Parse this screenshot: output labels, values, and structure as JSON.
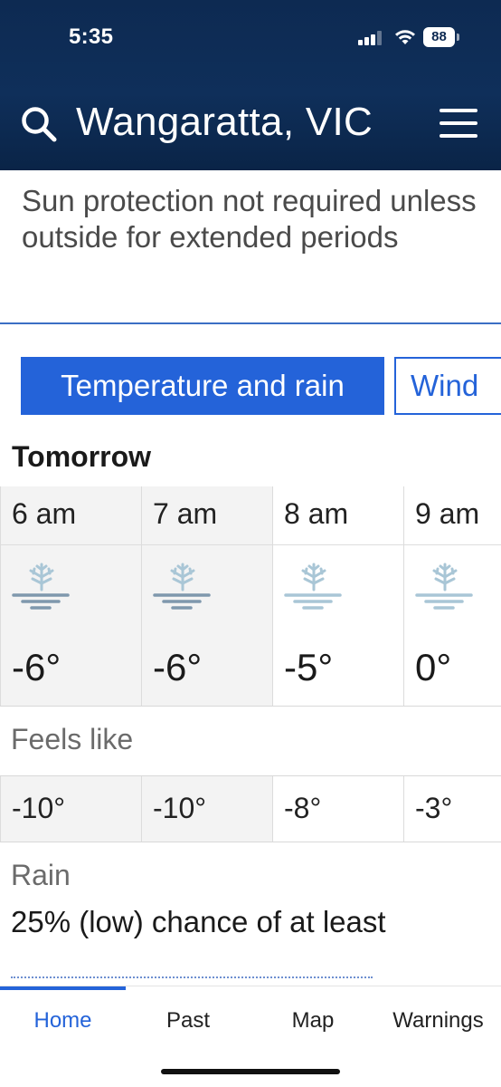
{
  "status_bar": {
    "time": "5:35",
    "battery": "88"
  },
  "header": {
    "location": "Wangaratta, VIC"
  },
  "sun_protection": {
    "text": "Sun protection not required unless outside for extended periods"
  },
  "tabs": [
    {
      "label": "Temperature and rain",
      "active": true
    },
    {
      "label": "Wind",
      "active": false
    }
  ],
  "forecast": {
    "day": "Tomorrow",
    "hours": [
      {
        "time": "6 am",
        "icon": "frost-icon",
        "temp": "-6°",
        "feels": "-10°"
      },
      {
        "time": "7 am",
        "icon": "frost-icon",
        "temp": "-6°",
        "feels": "-10°"
      },
      {
        "time": "8 am",
        "icon": "frost-icon",
        "temp": "-5°",
        "feels": "-8°"
      },
      {
        "time": "9 am",
        "icon": "frost-icon",
        "temp": "0°",
        "feels": "-3°"
      }
    ],
    "feels_like_label": "Feels like",
    "rain_label": "Rain",
    "rain_text": "25% (low) chance of at least"
  },
  "nav": [
    {
      "label": "Home",
      "active": true
    },
    {
      "label": "Past",
      "active": false
    },
    {
      "label": "Map",
      "active": false
    },
    {
      "label": "Warnings",
      "active": false
    }
  ],
  "colors": {
    "header_bg": "#0d2a52",
    "accent": "#2463d9",
    "frost_dark": "#7f98ad",
    "frost_light": "#a9c6d6"
  }
}
